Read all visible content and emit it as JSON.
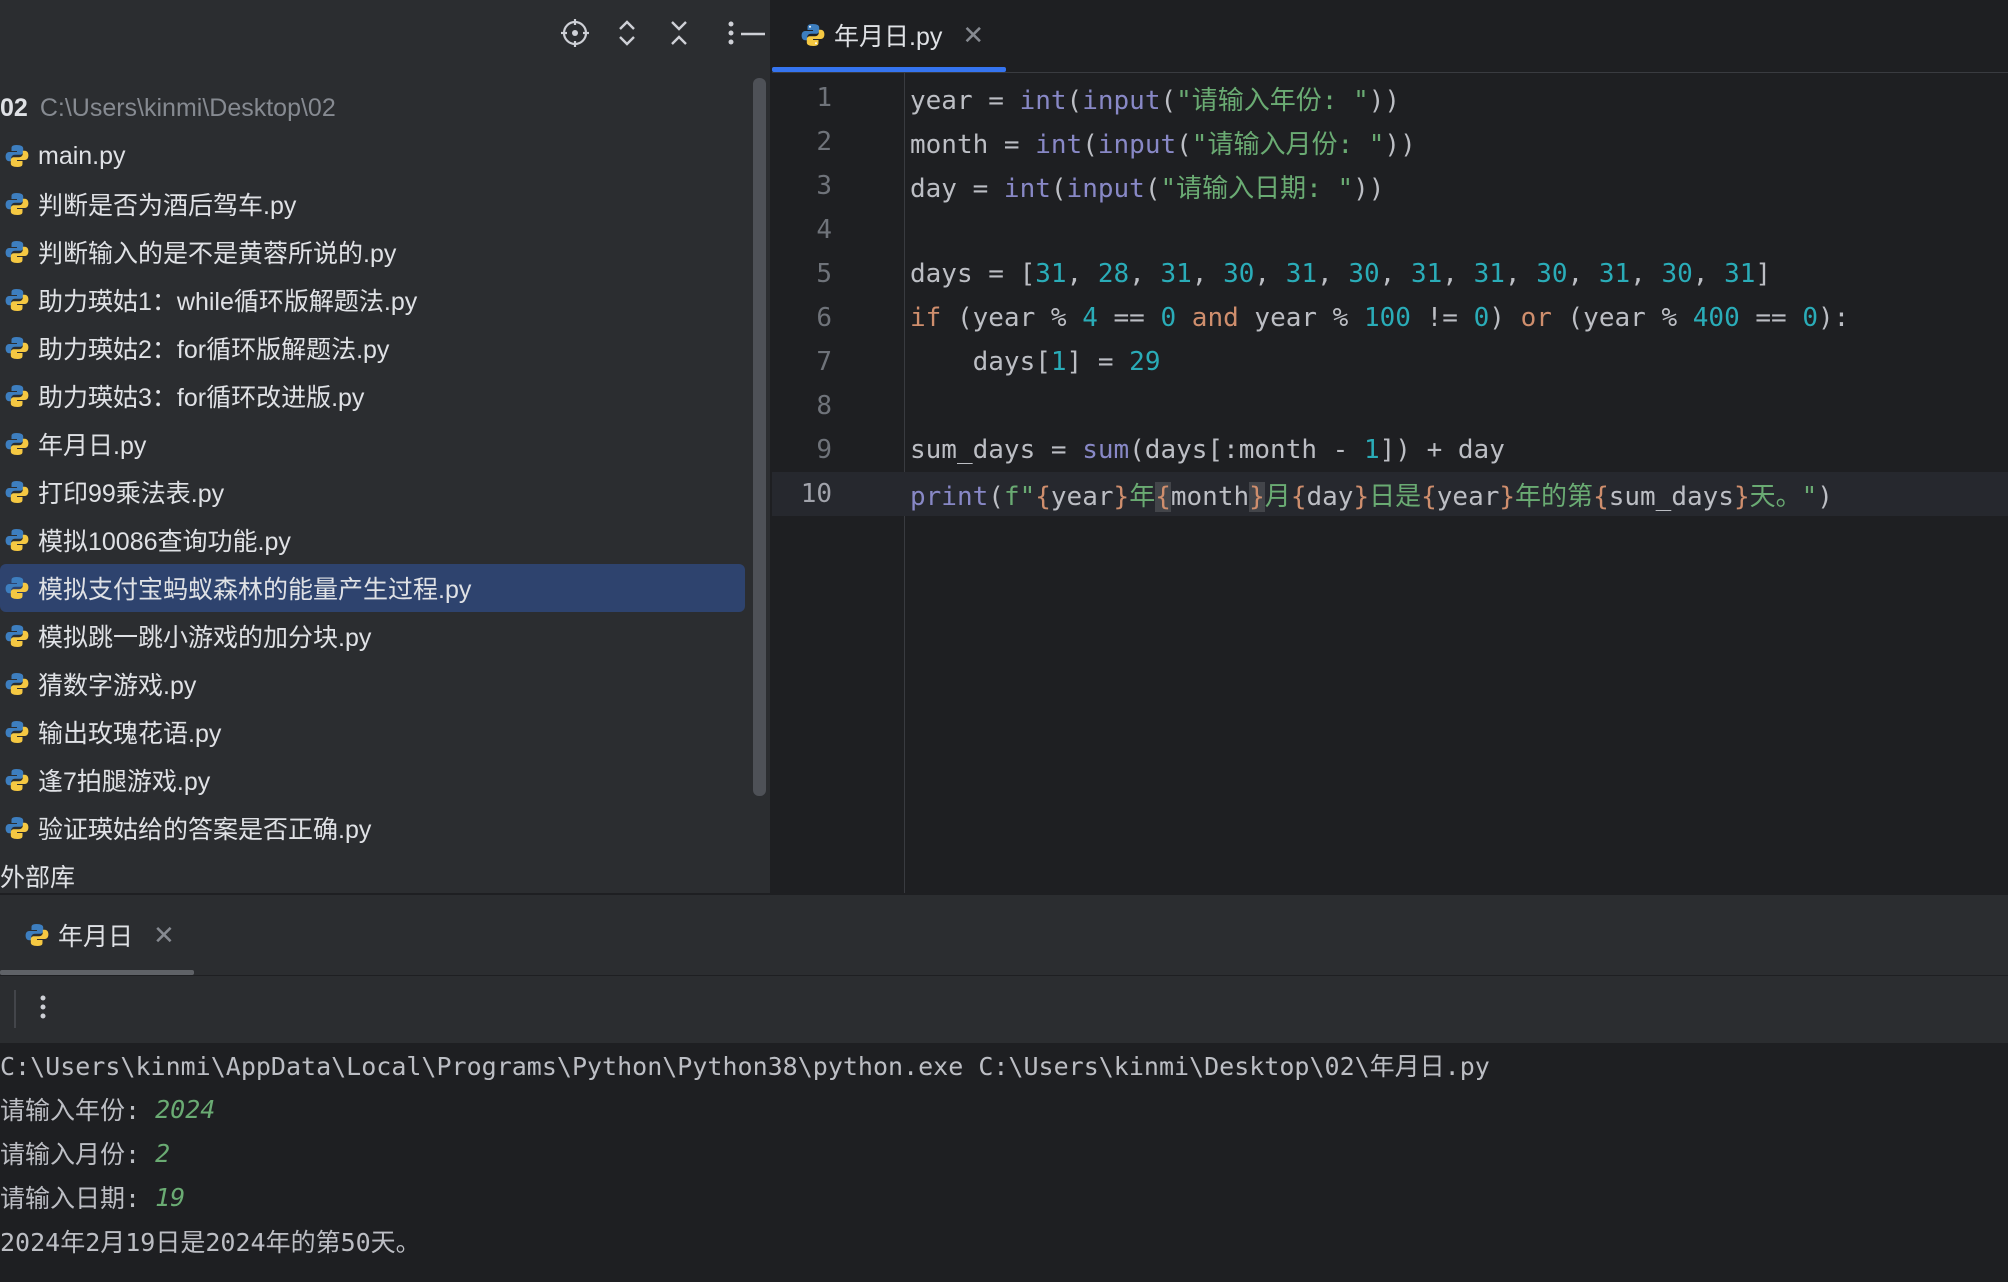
{
  "project": {
    "root_name": "02",
    "root_path": "C:\\Users\\kinmi\\Desktop\\02",
    "files": [
      {
        "name": "main.py",
        "selected": false
      },
      {
        "name": "判断是否为酒后驾车.py",
        "selected": false
      },
      {
        "name": "判断输入的是不是黄蓉所说的.py",
        "selected": false
      },
      {
        "name": "助力瑛姑1：while循环版解题法.py",
        "selected": false
      },
      {
        "name": "助力瑛姑2：for循环版解题法.py",
        "selected": false
      },
      {
        "name": "助力瑛姑3：for循环改进版.py",
        "selected": false
      },
      {
        "name": "年月日.py",
        "selected": false
      },
      {
        "name": "打印99乘法表.py",
        "selected": false
      },
      {
        "name": "模拟10086查询功能.py",
        "selected": false
      },
      {
        "name": "模拟支付宝蚂蚁森林的能量产生过程.py",
        "selected": true
      },
      {
        "name": "模拟跳一跳小游戏的加分块.py",
        "selected": false
      },
      {
        "name": "猜数字游戏.py",
        "selected": false
      },
      {
        "name": "输出玫瑰花语.py",
        "selected": false
      },
      {
        "name": "逢7拍腿游戏.py",
        "selected": false
      },
      {
        "name": "验证瑛姑给的答案是否正确.py",
        "selected": false
      }
    ],
    "external_libs": "外部库",
    "toolbar_icons": [
      "locate-icon",
      "expand-icon",
      "collapse-icon",
      "more-icon",
      "minimize-icon"
    ]
  },
  "editor": {
    "tab_label": "年月日.py",
    "close_glyph": "✕",
    "line_numbers": [
      "1",
      "2",
      "3",
      "4",
      "5",
      "6",
      "7",
      "8",
      "9",
      "10"
    ],
    "current_line": 10
  },
  "run": {
    "tab_label": "年月日",
    "close_glyph": "✕",
    "console": {
      "command": "C:\\Users\\kinmi\\AppData\\Local\\Programs\\Python\\Python38\\python.exe C:\\Users\\kinmi\\Desktop\\02\\年月日.py",
      "prompt_year": "请输入年份: ",
      "input_year": "2024",
      "prompt_month": "请输入月份: ",
      "input_month": "2",
      "prompt_day": "请输入日期: ",
      "input_day": "19",
      "result": "2024年2月19日是2024年的第50天。"
    }
  },
  "colors": {
    "keyword": "#cf8e6d",
    "builtin": "#8888c6",
    "number": "#2aacb8",
    "string": "#6aab73",
    "selection": "#2e436e",
    "accent": "#3574f0"
  }
}
